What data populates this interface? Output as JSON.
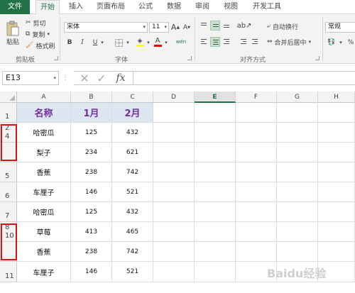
{
  "ribbon_tabs": [
    "文件",
    "开始",
    "插入",
    "页面布局",
    "公式",
    "数据",
    "审阅",
    "视图",
    "开发工具"
  ],
  "clipboard": {
    "paste": "粘贴",
    "cut": "剪切",
    "copy": "复制",
    "format_painter": "格式刷",
    "group": "剪贴板"
  },
  "font": {
    "name": "宋体",
    "size": "11",
    "bold": "B",
    "italic": "I",
    "underline": "U",
    "grow": "A",
    "shrink": "A",
    "font_color": "A",
    "phonetic": "wén",
    "group": "字体"
  },
  "alignment": {
    "wrap_text": "自动换行",
    "merge_center": "合并后居中",
    "group": "对齐方式"
  },
  "number": {
    "format": "常规",
    "percent": "%"
  },
  "formula_bar": {
    "name_box": "E13",
    "fx": "fx",
    "content": ""
  },
  "columns": [
    "A",
    "B",
    "C",
    "D",
    "E",
    "F",
    "G",
    "H"
  ],
  "selected_column": "E",
  "rows": [
    {
      "header": "1",
      "header_top": "",
      "cells": [
        "名称",
        "1月",
        "2月"
      ]
    },
    {
      "header": "4",
      "header_top": "2",
      "cells": [
        "哈密瓜",
        "125",
        "432"
      ]
    },
    {
      "header": "",
      "header_top": "",
      "cells": [
        "梨子",
        "234",
        "621"
      ]
    },
    {
      "header": "5",
      "header_top": "",
      "cells": [
        "香蕉",
        "238",
        "742"
      ]
    },
    {
      "header": "6",
      "header_top": "",
      "cells": [
        "车厘子",
        "146",
        "521"
      ]
    },
    {
      "header": "7",
      "header_top": "",
      "cells": [
        "哈密瓜",
        "125",
        "432"
      ]
    },
    {
      "header": "10",
      "header_top": "8",
      "cells": [
        "草莓",
        "413",
        "465"
      ]
    },
    {
      "header": "",
      "header_top": "",
      "cells": [
        "香蕉",
        "238",
        "742"
      ]
    },
    {
      "header": "11",
      "header_top": "",
      "cells": [
        "车厘子",
        "146",
        "521"
      ]
    }
  ],
  "watermark": "Baidu经验",
  "colors": {
    "excel_green": "#217346",
    "header_fill": "#dce6f1",
    "header_text": "#7030a0",
    "highlight_red": "#e01010"
  }
}
